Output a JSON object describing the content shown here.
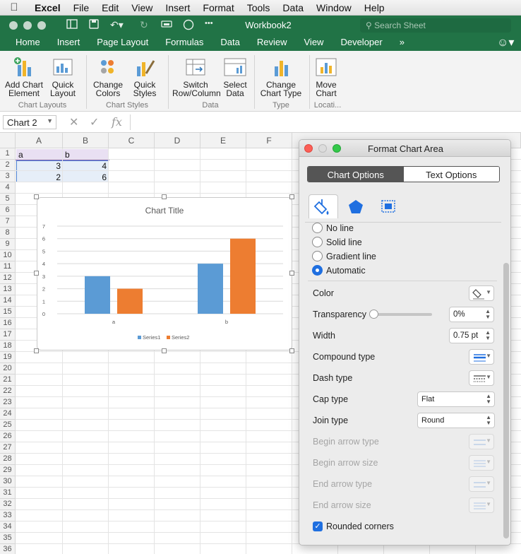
{
  "menubar": {
    "app": "Excel",
    "items": [
      "File",
      "Edit",
      "View",
      "Insert",
      "Format",
      "Tools",
      "Data",
      "Window",
      "Help"
    ]
  },
  "window": {
    "title": "Workbook2"
  },
  "search": {
    "placeholder": "Search Sheet"
  },
  "tabs": [
    "Home",
    "Insert",
    "Page Layout",
    "Formulas",
    "Data",
    "Review",
    "View",
    "Developer"
  ],
  "ribbon": {
    "buttons": [
      {
        "label1": "Add Chart",
        "label2": "Element"
      },
      {
        "label1": "Quick",
        "label2": "Layout"
      },
      {
        "label1": "Change",
        "label2": "Colors"
      },
      {
        "label1": "Quick",
        "label2": "Styles"
      },
      {
        "label1": "Switch",
        "label2": "Row/Column"
      },
      {
        "label1": "Select",
        "label2": "Data"
      },
      {
        "label1": "Change",
        "label2": "Chart Type"
      },
      {
        "label1": "Move",
        "label2": "Chart"
      }
    ],
    "groups": [
      "Chart Layouts",
      "Chart Styles",
      "Data",
      "Type",
      "Locati..."
    ]
  },
  "formula_bar": {
    "name_box": "Chart 2",
    "fx": "fx"
  },
  "sheet": {
    "columns": [
      "A",
      "B",
      "C",
      "D",
      "E",
      "F"
    ],
    "rows": [
      "1",
      "2",
      "3",
      "4",
      "5",
      "6",
      "7",
      "8",
      "9",
      "10",
      "11",
      "12",
      "13",
      "14",
      "15",
      "16",
      "17",
      "18",
      "19",
      "20",
      "21",
      "22",
      "23",
      "24",
      "25",
      "26",
      "27",
      "28",
      "29",
      "30",
      "31",
      "32",
      "33",
      "34",
      "35",
      "36"
    ],
    "cells": {
      "A1": "a",
      "B1": "b",
      "A2": "3",
      "B2": "4",
      "A3": "2",
      "B3": "6"
    }
  },
  "chart_data": {
    "type": "bar",
    "title": "Chart Title",
    "categories": [
      "a",
      "b"
    ],
    "series": [
      {
        "name": "Series1",
        "values": [
          3,
          4
        ],
        "color": "#5b9bd5"
      },
      {
        "name": "Series2",
        "values": [
          2,
          6
        ],
        "color": "#ed7d31"
      }
    ],
    "ylim": [
      0,
      7
    ],
    "yticks": [
      "0",
      "1",
      "2",
      "3",
      "4",
      "5",
      "6",
      "7"
    ],
    "grid": true,
    "legend": "bottom"
  },
  "panel": {
    "title": "Format Chart Area",
    "seg_on": "Chart Options",
    "seg_off": "Text Options",
    "line_options": [
      "No line",
      "Solid line",
      "Gradient line",
      "Automatic"
    ],
    "selected_line": "Automatic",
    "color_label": "Color",
    "transparency_label": "Transparency",
    "transparency_value": "0%",
    "width_label": "Width",
    "width_value": "0.75 pt",
    "compound_label": "Compound type",
    "dash_label": "Dash type",
    "cap_label": "Cap type",
    "cap_value": "Flat",
    "join_label": "Join type",
    "join_value": "Round",
    "begin_arrow_type": "Begin arrow type",
    "begin_arrow_size": "Begin arrow size",
    "end_arrow_type": "End arrow type",
    "end_arrow_size": "End arrow size",
    "rounded_corners": "Rounded corners",
    "rounded_checked": true
  },
  "colors": {
    "excel_green": "#217346",
    "accent_blue": "#1f6fe0"
  }
}
